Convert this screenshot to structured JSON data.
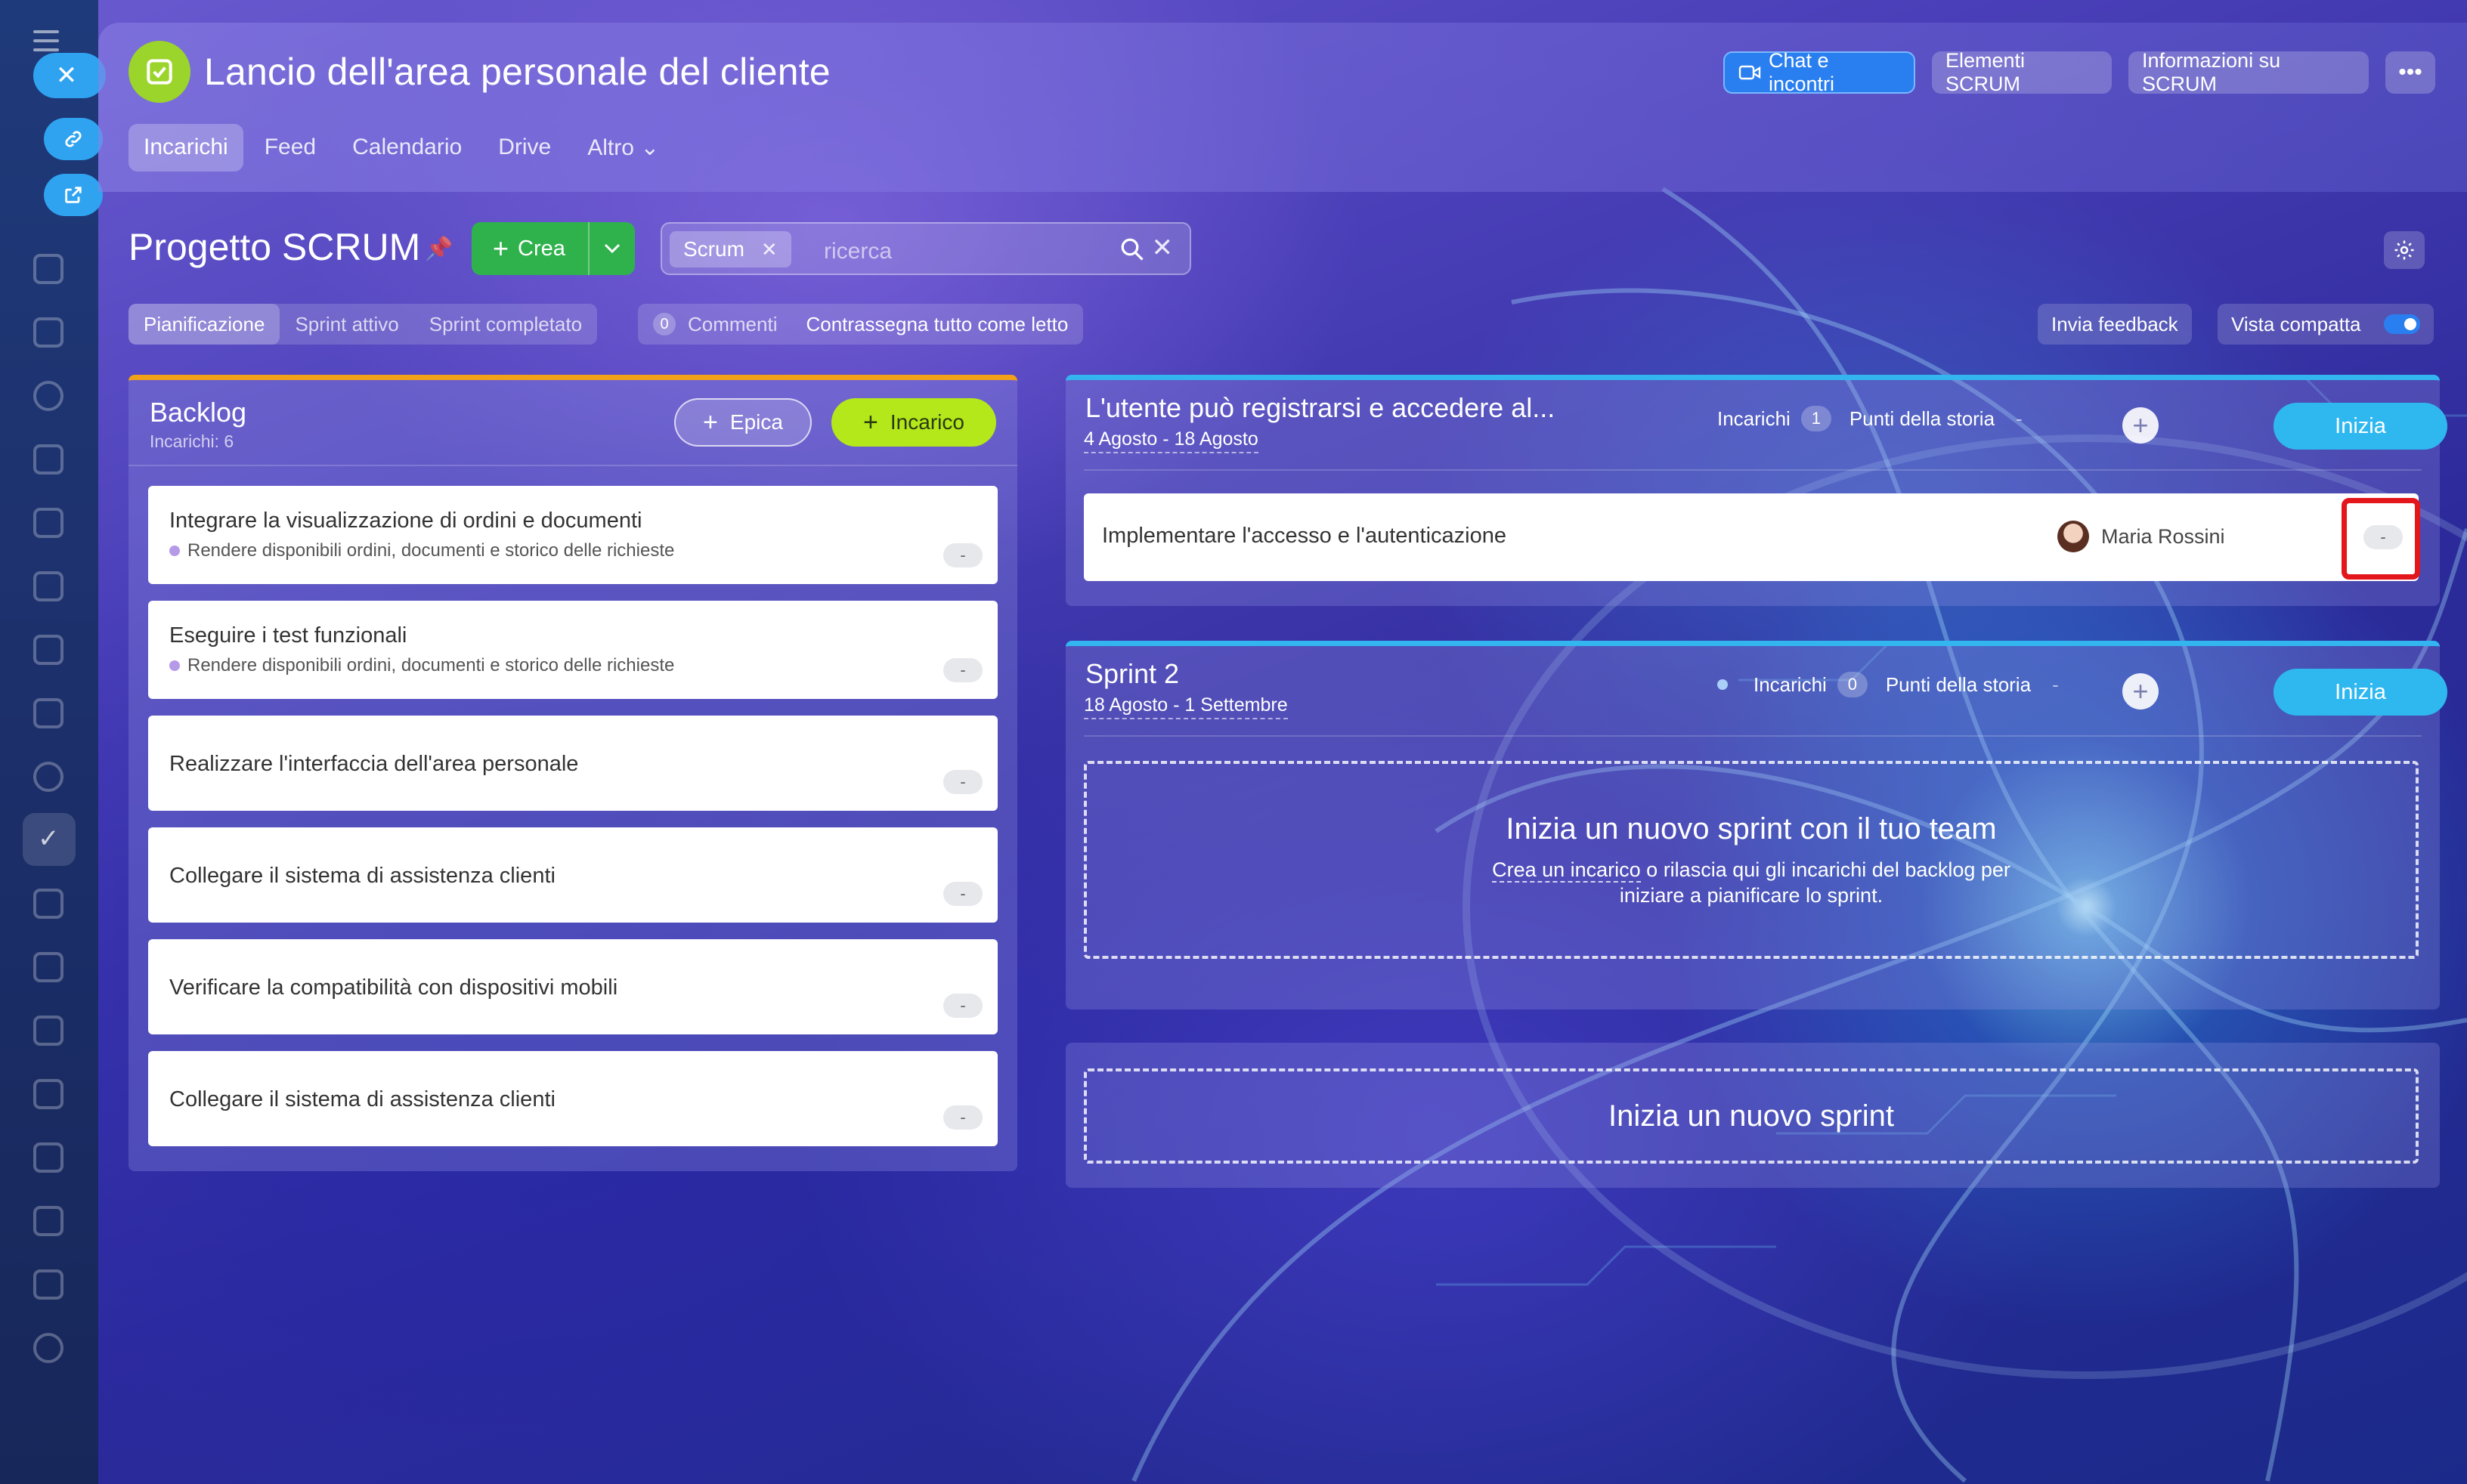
{
  "header": {
    "title": "Lancio dell'area personale del cliente",
    "buttons": {
      "chat": "Chat e incontri",
      "elements": "Elementi SCRUM",
      "info": "Informazioni su SCRUM",
      "more": "•••"
    },
    "nav": [
      {
        "label": "Incarichi",
        "active": true
      },
      {
        "label": "Feed"
      },
      {
        "label": "Calendario"
      },
      {
        "label": "Drive"
      },
      {
        "label": "Altro ⌄"
      }
    ]
  },
  "toolbar": {
    "project_title": "Progetto SCRUM",
    "create_label": "Crea",
    "filter_chip": "Scrum",
    "search_placeholder": "ricerca"
  },
  "tabs": [
    "Pianificazione",
    "Sprint attivo",
    "Sprint completato"
  ],
  "comments": {
    "count": "0",
    "label": "Commenti",
    "mark_read": "Contrassegna tutto come letto"
  },
  "right_controls": {
    "feedback": "Invia feedback",
    "compact_view": "Vista compatta",
    "compact_on": true
  },
  "backlog": {
    "title": "Backlog",
    "subtitle": "Incarichi: 6",
    "epic_button": "Epica",
    "task_button": "Incarico",
    "cards": [
      {
        "title": "Integrare la visualizzazione di ordini e documenti",
        "epic": "Rendere disponibili ordini, documenti e storico delle richieste",
        "points": "-"
      },
      {
        "title": "Eseguire i test funzionali",
        "epic": "Rendere disponibili ordini, documenti e storico delle richieste",
        "points": "-"
      },
      {
        "title": "Realizzare l'interfaccia dell'area personale",
        "points": "-"
      },
      {
        "title": "Collegare il sistema di assistenza clienti",
        "points": "-"
      },
      {
        "title": "Verificare la compatibilità con dispositivi mobili",
        "points": "-"
      },
      {
        "title": "Collegare il sistema di assistenza clienti",
        "points": "-"
      }
    ]
  },
  "sprints": [
    {
      "title": "L'utente può registrarsi e accedere al...",
      "dates": "4 Agosto - 18 Agosto",
      "tasks_label": "Incarichi",
      "tasks_count": "1",
      "story_points_label": "Punti della storia",
      "story_points": "-",
      "start_label": "Inizia",
      "task": {
        "title": "Implementare l'accesso e l'autenticazione",
        "assignee": "Maria Rossini",
        "points": "-"
      }
    },
    {
      "title": "Sprint 2",
      "dates": "18 Agosto - 1 Settembre",
      "tasks_label": "Incarichi",
      "tasks_count": "0",
      "story_points_label": "Punti della storia",
      "story_points": "-",
      "start_label": "Inizia",
      "empty_title": "Inizia un nuovo sprint con il tuo team",
      "empty_link": "Crea un incarico",
      "empty_text_1": " o rilascia qui gli incarichi del backlog per",
      "empty_text_2": "iniziare a pianificare lo sprint."
    }
  ],
  "new_sprint_label": "Inizia un nuovo sprint",
  "colors": {
    "accent_blue": "#2fb8f0",
    "create_green": "#2fb24c",
    "task_lime": "#b4e81a",
    "backlog_orange": "#f2a218",
    "highlight_red": "#e3171b"
  }
}
